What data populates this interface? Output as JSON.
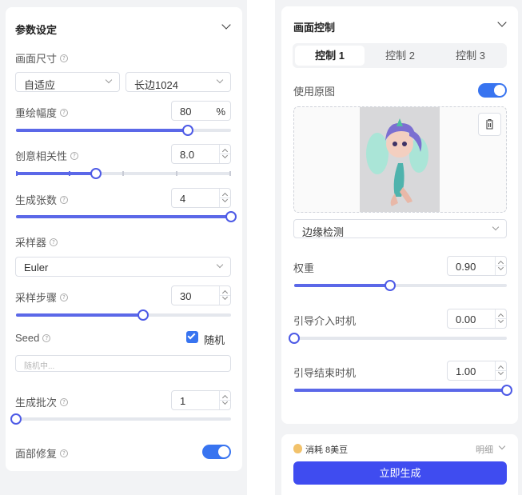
{
  "left_panel": {
    "title": "参数设定",
    "image_size": {
      "label": "画面尺寸",
      "mode": "自适应",
      "edge": "长边1024"
    },
    "redraw": {
      "label": "重绘幅度",
      "value": "80",
      "unit": "%",
      "percent": 0.8
    },
    "creativity": {
      "label": "创意相关性",
      "value": "8.0",
      "percent": 0.37
    },
    "count": {
      "label": "生成张数",
      "value": "4",
      "percent": 1.0
    },
    "sampler": {
      "label": "采样器",
      "value": "Euler"
    },
    "steps": {
      "label": "采样步骤",
      "value": "30",
      "percent": 0.59
    },
    "seed": {
      "label": "Seed",
      "random_label": "随机",
      "placeholder": "随机中..."
    },
    "batch": {
      "label": "生成批次",
      "value": "1",
      "percent": 0.0
    },
    "face_fix": {
      "label": "面部修复",
      "enabled": true
    }
  },
  "right_panel": {
    "title": "画面控制",
    "tabs": [
      {
        "label": "控制 1",
        "active": true
      },
      {
        "label": "控制 2",
        "active": false
      },
      {
        "label": "控制 3",
        "active": false
      }
    ],
    "use_original": {
      "label": "使用原图",
      "enabled": true
    },
    "preview_icon": "fairy-character-image",
    "delete_icon": "trash-icon",
    "preprocessor": "边缘检测",
    "weight": {
      "label": "权重",
      "value": "0.90",
      "percent": 0.45
    },
    "guidance_start": {
      "label": "引导介入时机",
      "value": "0.00",
      "percent": 0.0
    },
    "guidance_end": {
      "label": "引导结束时机",
      "value": "1.00",
      "percent": 1.0
    }
  },
  "footer": {
    "cost_text": "消耗 8美豆",
    "detail_label": "明细",
    "generate_label": "立即生成"
  },
  "colors": {
    "accent": "#3f4cf0",
    "slider": "#5b68e8",
    "toggle": "#3874f0"
  }
}
